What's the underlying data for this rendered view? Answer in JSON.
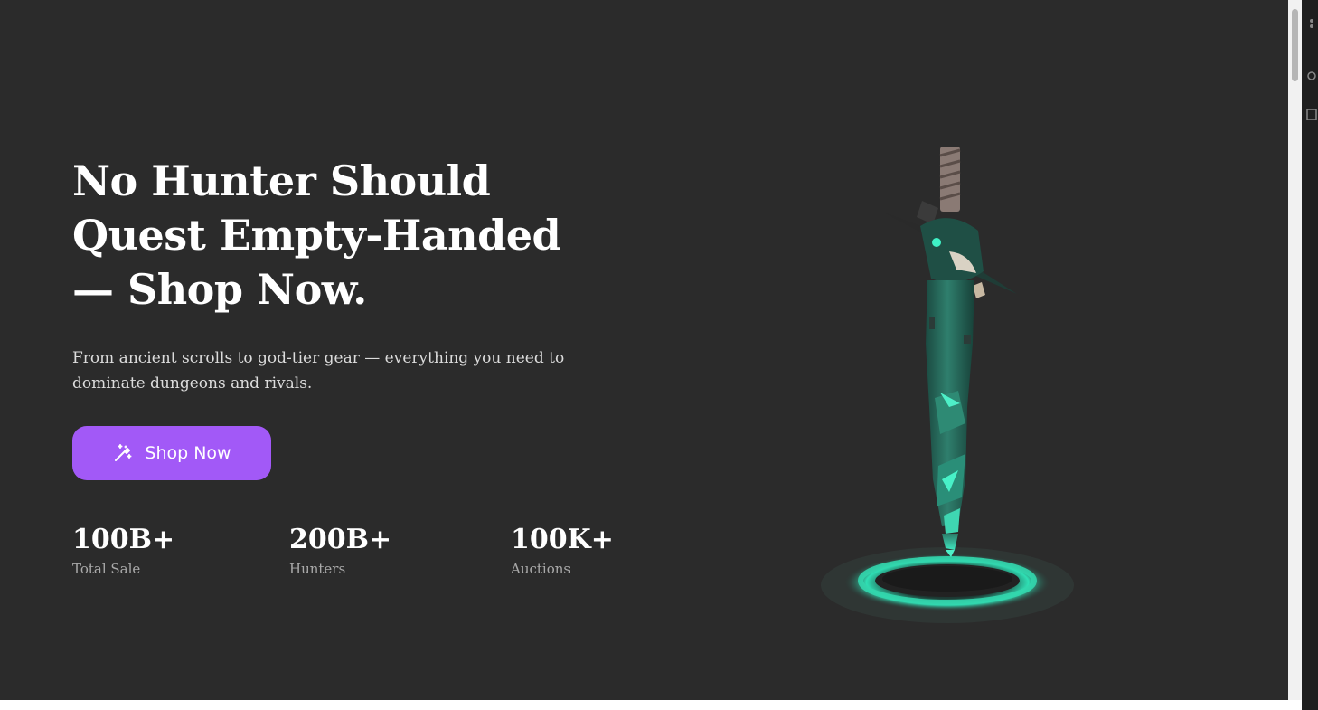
{
  "hero": {
    "headline": "No Hunter Should Quest Empty-Handed — Shop Now.",
    "subtext": "From ancient scrolls to god-tier gear — everything you need to dominate dungeons and rivals.",
    "cta_label": "Shop Now",
    "cta_icon": "magic-wand-icon",
    "stats": [
      {
        "value": "100B+",
        "label": "Total Sale"
      },
      {
        "value": "200B+",
        "label": "Hunters"
      },
      {
        "value": "100K+",
        "label": "Auctions"
      }
    ],
    "image_subject": "teal crystal greatsword hovering over glowing portal"
  },
  "colors": {
    "background": "#2b2b2b",
    "accent": "#a259f7",
    "headline": "#ffffff",
    "muted": "#a9a9a9",
    "glow": "#2fe0b5"
  }
}
